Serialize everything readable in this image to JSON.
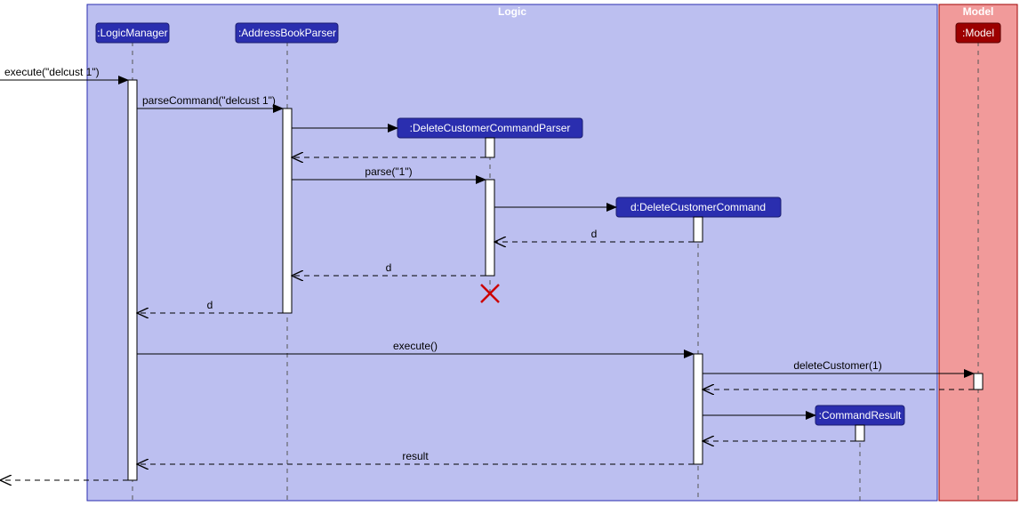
{
  "frames": {
    "logic": {
      "label": "Logic"
    },
    "model": {
      "label": "Model"
    }
  },
  "lifelines": {
    "logicManager": ":LogicManager",
    "addressBookParser": ":AddressBookParser",
    "deleteCustomerCommandParser": ":DeleteCustomerCommandParser",
    "deleteCustomerCommand": "d:DeleteCustomerCommand",
    "commandResult": ":CommandResult",
    "model": ":Model"
  },
  "messages": {
    "executeDelcust": "execute(\"delcust 1\")",
    "parseCommand": "parseCommand(\"delcust 1\")",
    "parse1": "parse(\"1\")",
    "d1": "d",
    "d2": "d",
    "d3": "d",
    "execute": "execute()",
    "deleteCustomer": "deleteCustomer(1)",
    "result": "result"
  },
  "chart_data": {
    "type": "sequence-diagram",
    "frames": [
      {
        "name": "Logic",
        "participants": [
          ":LogicManager",
          ":AddressBookParser",
          ":DeleteCustomerCommandParser",
          "d:DeleteCustomerCommand",
          ":CommandResult"
        ]
      },
      {
        "name": "Model",
        "participants": [
          ":Model"
        ]
      }
    ],
    "messages": [
      {
        "from": "caller",
        "to": ":LogicManager",
        "label": "execute(\"delcust 1\")",
        "type": "sync"
      },
      {
        "from": ":LogicManager",
        "to": ":AddressBookParser",
        "label": "parseCommand(\"delcust 1\")",
        "type": "sync"
      },
      {
        "from": ":AddressBookParser",
        "to": ":DeleteCustomerCommandParser",
        "label": "",
        "type": "create"
      },
      {
        "from": ":DeleteCustomerCommandParser",
        "to": ":AddressBookParser",
        "label": "",
        "type": "return"
      },
      {
        "from": ":AddressBookParser",
        "to": ":DeleteCustomerCommandParser",
        "label": "parse(\"1\")",
        "type": "sync"
      },
      {
        "from": ":DeleteCustomerCommandParser",
        "to": "d:DeleteCustomerCommand",
        "label": "",
        "type": "create"
      },
      {
        "from": "d:DeleteCustomerCommand",
        "to": ":DeleteCustomerCommandParser",
        "label": "d",
        "type": "return"
      },
      {
        "from": ":DeleteCustomerCommandParser",
        "to": ":AddressBookParser",
        "label": "d",
        "type": "return"
      },
      {
        "from": ":DeleteCustomerCommandParser",
        "to": null,
        "label": "",
        "type": "destroy"
      },
      {
        "from": ":AddressBookParser",
        "to": ":LogicManager",
        "label": "d",
        "type": "return"
      },
      {
        "from": ":LogicManager",
        "to": "d:DeleteCustomerCommand",
        "label": "execute()",
        "type": "sync"
      },
      {
        "from": "d:DeleteCustomerCommand",
        "to": ":Model",
        "label": "deleteCustomer(1)",
        "type": "sync"
      },
      {
        "from": ":Model",
        "to": "d:DeleteCustomerCommand",
        "label": "",
        "type": "return"
      },
      {
        "from": "d:DeleteCustomerCommand",
        "to": ":CommandResult",
        "label": "",
        "type": "create"
      },
      {
        "from": ":CommandResult",
        "to": "d:DeleteCustomerCommand",
        "label": "",
        "type": "return"
      },
      {
        "from": "d:DeleteCustomerCommand",
        "to": ":LogicManager",
        "label": "result",
        "type": "return"
      },
      {
        "from": ":LogicManager",
        "to": "caller",
        "label": "",
        "type": "return"
      }
    ]
  }
}
